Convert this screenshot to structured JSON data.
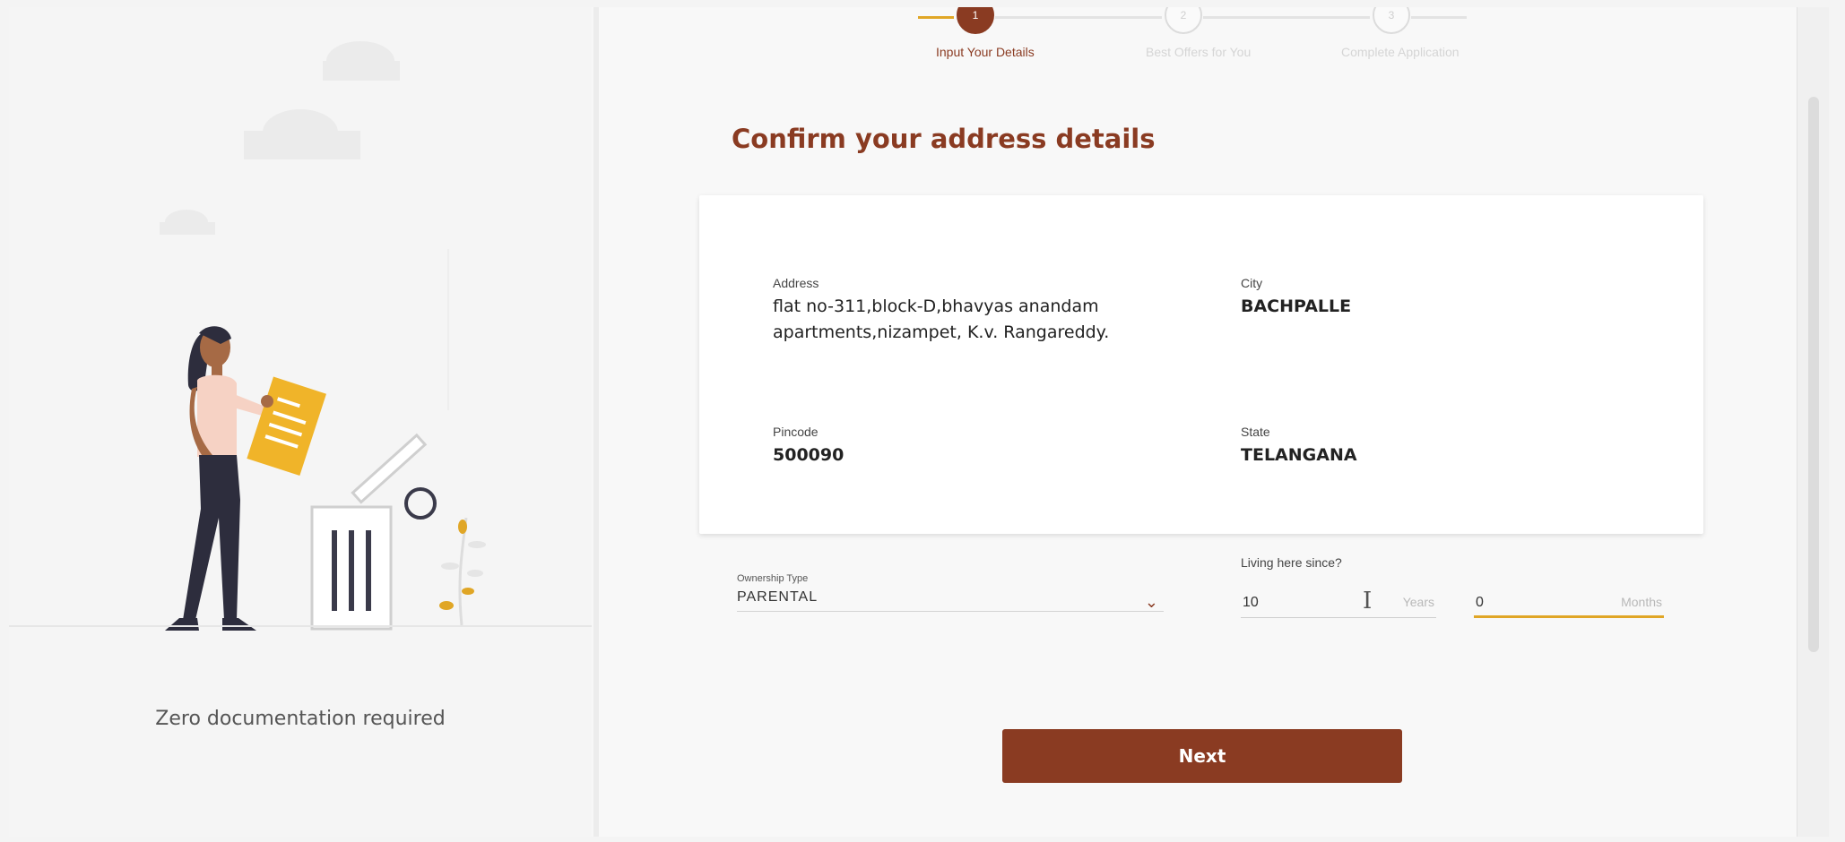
{
  "left_panel": {
    "caption": "Zero documentation required"
  },
  "stepper": {
    "steps": [
      {
        "number": "1",
        "label": "Input Your Details",
        "state": "active"
      },
      {
        "number": "2",
        "label": "Best Offers for You",
        "state": "pending"
      },
      {
        "number": "3",
        "label": "Complete Application",
        "state": "pending"
      }
    ]
  },
  "main": {
    "title": "Confirm your address details",
    "address": {
      "address_label": "Address",
      "address_line1": "flat no-311,block-D,bhavyas anandam",
      "address_line2": "apartments,nizampet, K.v. Rangareddy.",
      "city_label": "City",
      "city_value": "BACHPALLE",
      "pincode_label": "Pincode",
      "pincode_value": "500090",
      "state_label": "State",
      "state_value": "TELANGANA"
    },
    "ownership": {
      "label": "Ownership Type",
      "value": "PARENTAL"
    },
    "living_since": {
      "label": "Living here since?",
      "years_value": "10",
      "years_unit": "Years",
      "months_value": "0",
      "months_unit": "Months"
    },
    "next_label": "Next"
  },
  "colors": {
    "brand": "#8a3b22",
    "accent": "#e0a626"
  }
}
